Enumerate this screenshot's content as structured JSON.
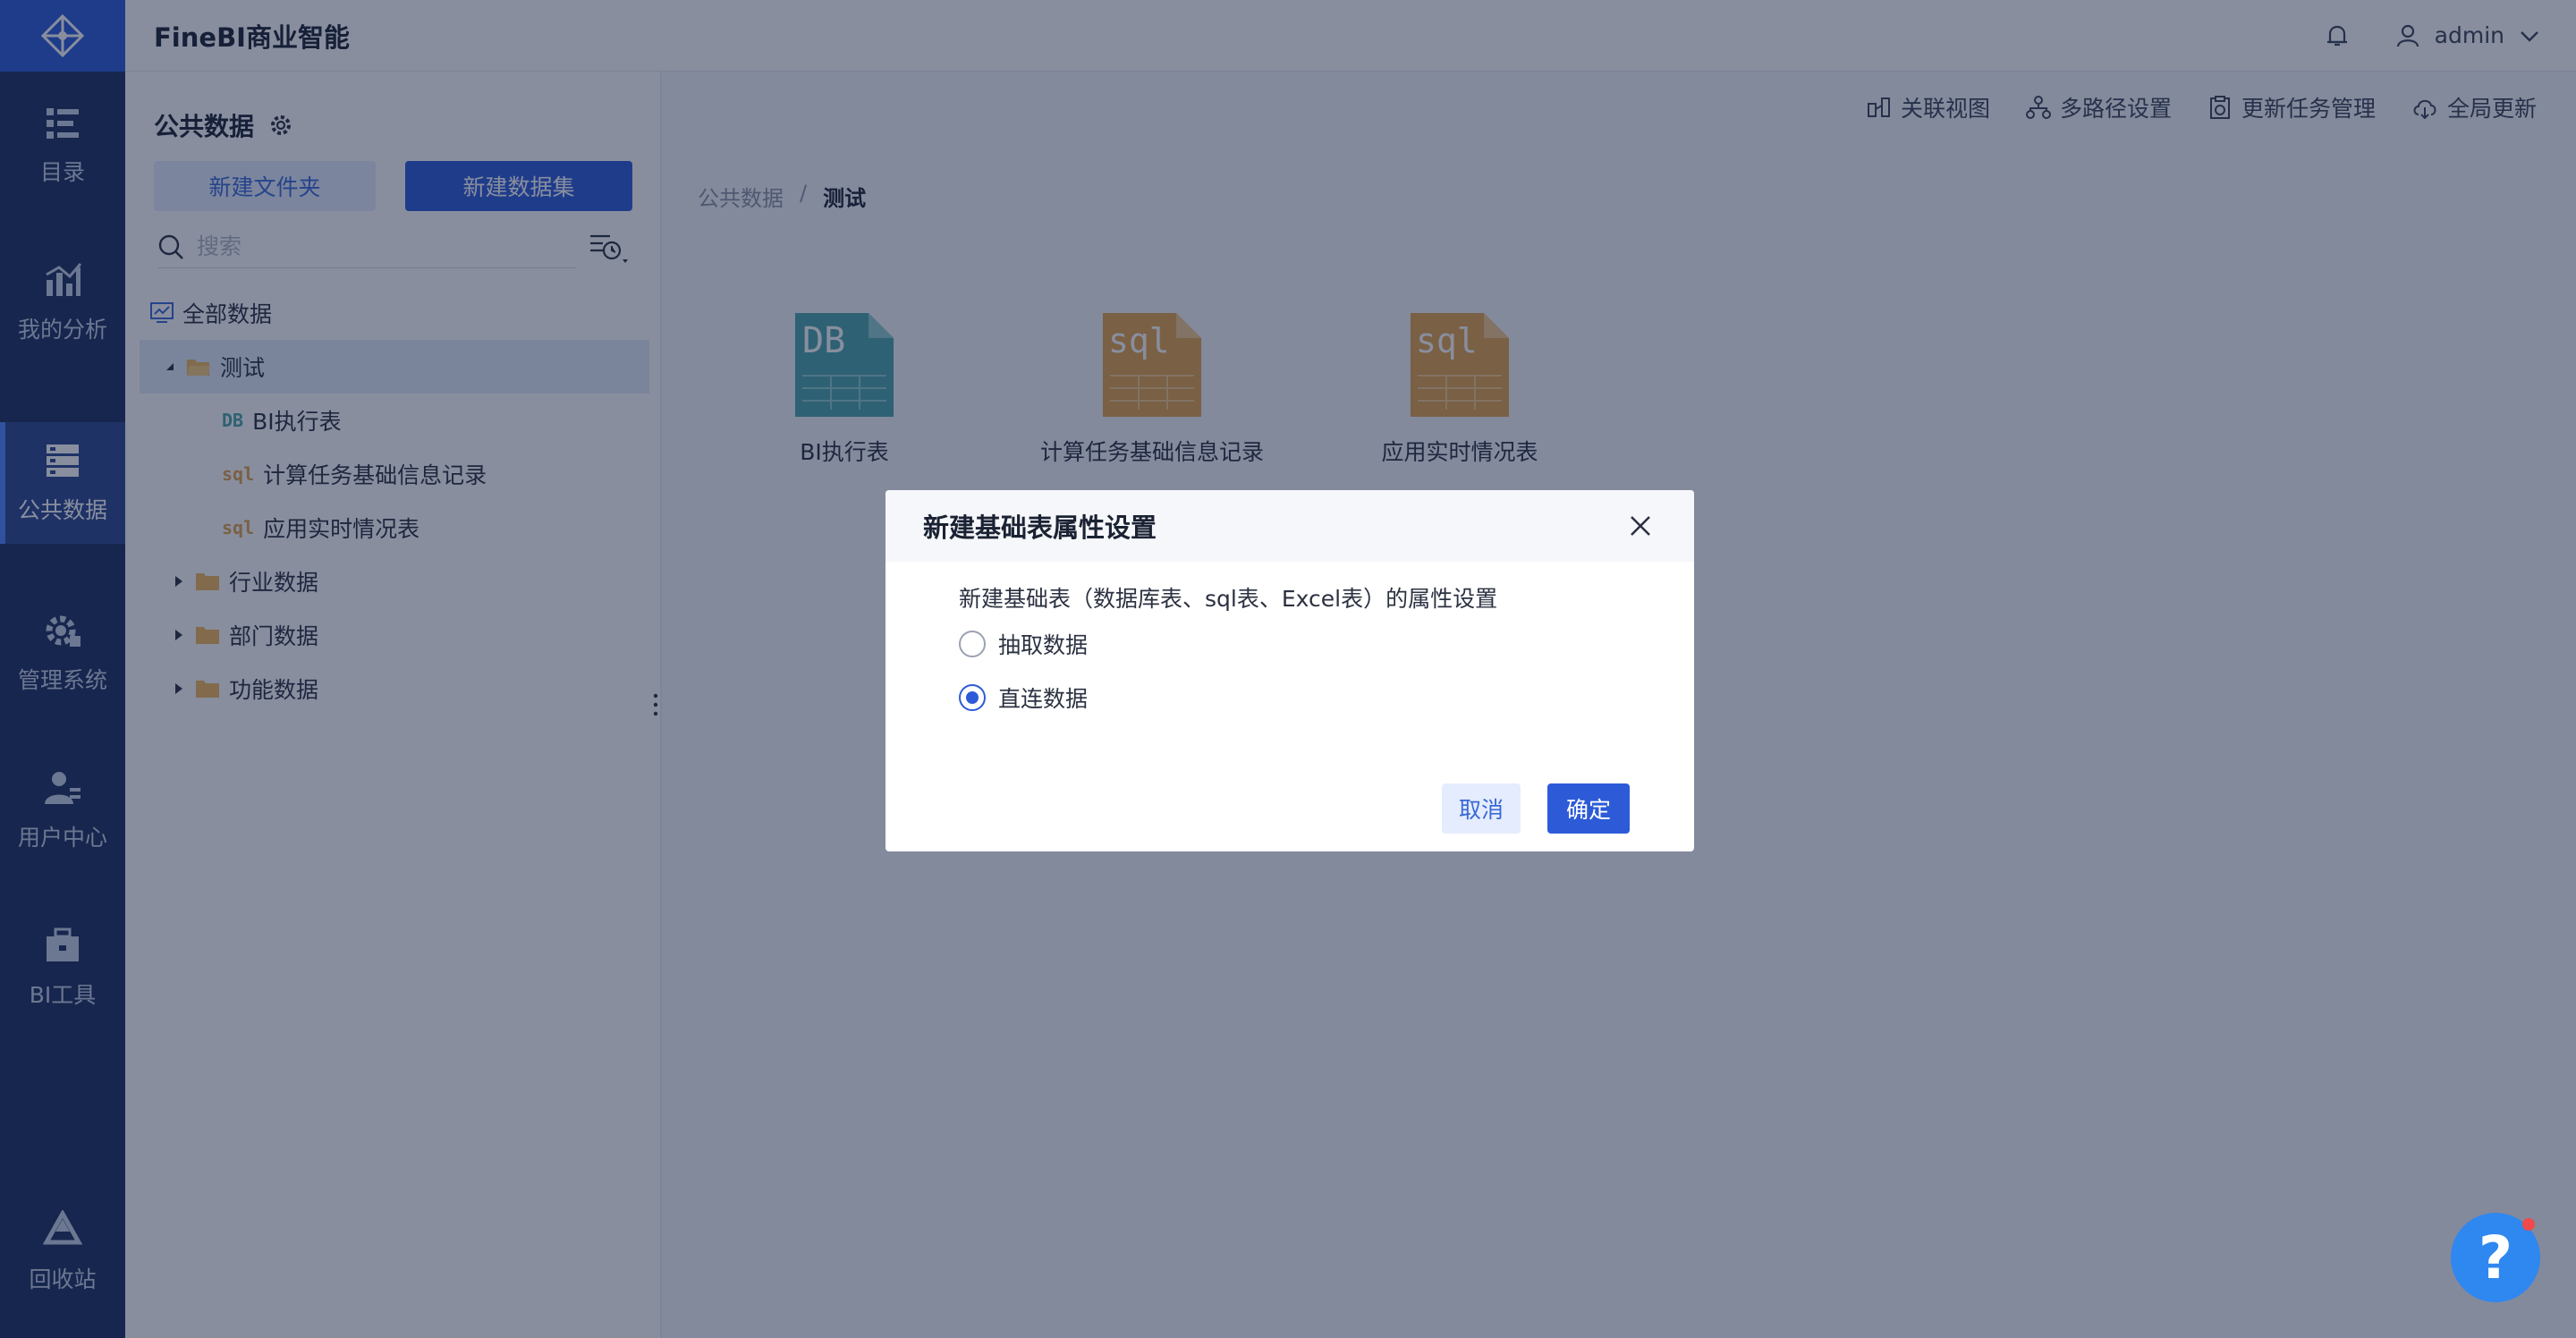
{
  "app": {
    "title": "FineBI商业智能"
  },
  "nav": {
    "items": [
      {
        "label": "目录",
        "icon": "catalog-icon"
      },
      {
        "label": "我的分析",
        "icon": "analysis-icon"
      },
      {
        "label": "公共数据",
        "icon": "public-data-icon",
        "active": true
      },
      {
        "label": "管理系统",
        "icon": "gear-icon"
      },
      {
        "label": "用户中心",
        "icon": "user-center-icon"
      },
      {
        "label": "BI工具",
        "icon": "toolbox-icon"
      },
      {
        "label": "回收站",
        "icon": "recycle-bin-icon"
      }
    ]
  },
  "header": {
    "user": "admin"
  },
  "sidebar": {
    "title": "公共数据",
    "new_folder": "新建文件夹",
    "new_dataset": "新建数据集",
    "search_placeholder": "搜索",
    "tree": {
      "all": "全部数据",
      "folder_test": "测试",
      "item_bi": "BI执行表",
      "item_calc": "计算任务基础信息记录",
      "item_app": "应用实时情况表",
      "folder_industry": "行业数据",
      "folder_dept": "部门数据",
      "folder_func": "功能数据"
    }
  },
  "toolbar": {
    "relation_view": "关联视图",
    "multipath": "多路径设置",
    "update_task": "更新任务管理",
    "global_update": "全局更新"
  },
  "breadcrumb": {
    "root": "公共数据",
    "sep": "/",
    "current": "测试"
  },
  "files": [
    {
      "name": "BI执行表",
      "badge": "DB",
      "color": "#4aa5a8"
    },
    {
      "name": "计算任务基础信息记录",
      "badge": "sql",
      "color": "#e3a24a"
    },
    {
      "name": "应用实时情况表",
      "badge": "sql",
      "color": "#e3a24a"
    }
  ],
  "modal": {
    "title": "新建基础表属性设置",
    "desc": "新建基础表（数据库表、sql表、Excel表）的属性设置",
    "option_extract": "抽取数据",
    "option_direct": "直连数据",
    "selected": "直连数据",
    "cancel": "取消",
    "ok": "确定"
  },
  "help": {
    "label": "?"
  }
}
